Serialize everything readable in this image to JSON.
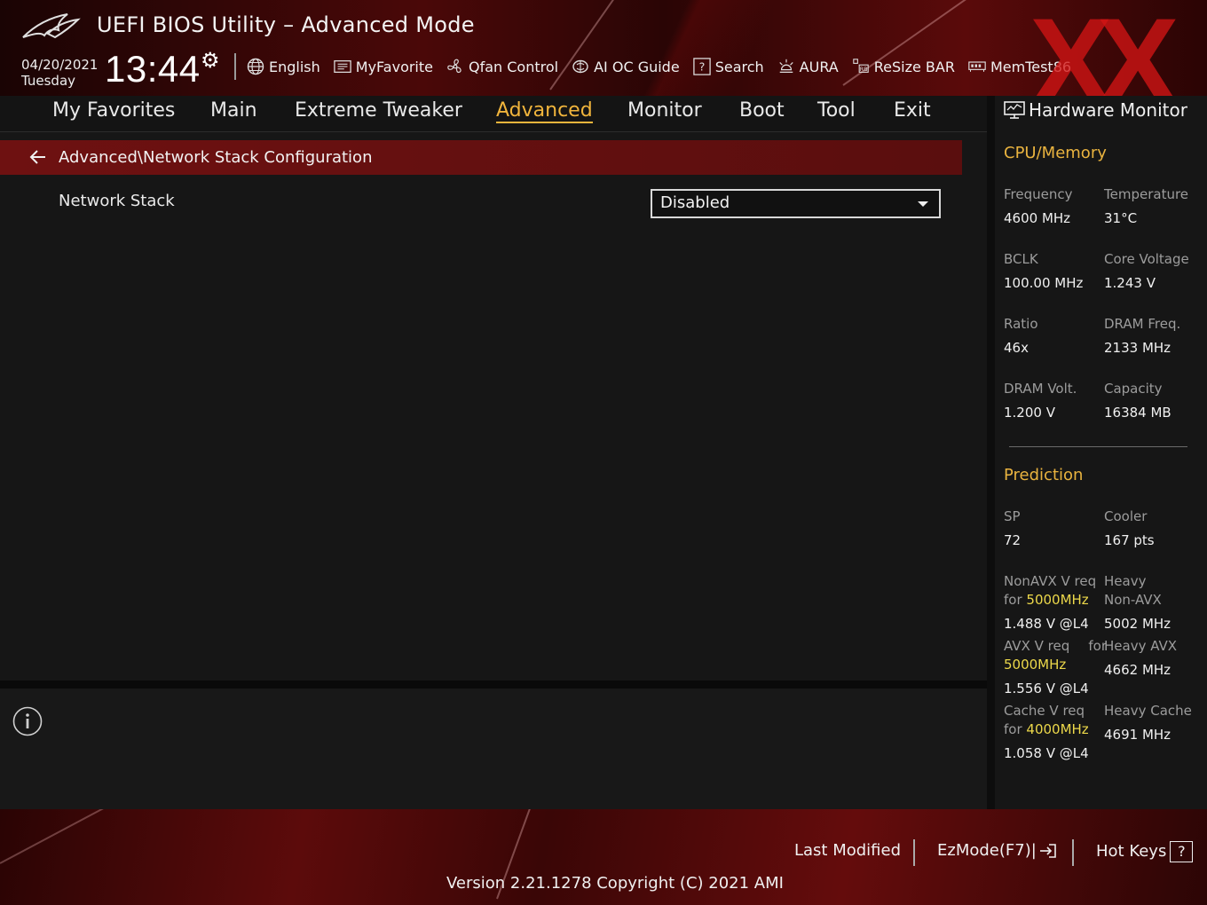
{
  "header": {
    "title": "UEFI BIOS Utility – Advanced Mode",
    "date": "04/20/2021",
    "weekday": "Tuesday",
    "time": "13:44",
    "watermark": "XX",
    "toolbar": [
      {
        "label": "English",
        "icon": "globe-icon"
      },
      {
        "label": "MyFavorite",
        "icon": "favorite-list-icon"
      },
      {
        "label": "Qfan Control",
        "icon": "fan-icon"
      },
      {
        "label": "AI OC Guide",
        "icon": "chip-icon"
      },
      {
        "label": "Search",
        "icon": "search-help-icon"
      },
      {
        "label": "AURA",
        "icon": "aura-light-icon"
      },
      {
        "label": "ReSize BAR",
        "icon": "resize-bar-icon"
      },
      {
        "label": "MemTest86",
        "icon": "memory-icon"
      }
    ]
  },
  "menu": {
    "items": [
      "My Favorites",
      "Main",
      "Extreme Tweaker",
      "Advanced",
      "Monitor",
      "Boot",
      "Tool",
      "Exit"
    ],
    "active": "Advanced"
  },
  "main": {
    "breadcrumb": "Advanced\\Network Stack Configuration",
    "settings": [
      {
        "label": "Network Stack",
        "value": "Disabled"
      }
    ]
  },
  "hardware_monitor": {
    "title": "Hardware Monitor",
    "cpu_memory": {
      "heading": "CPU/Memory",
      "frequency_label": "Frequency",
      "frequency": "4600 MHz",
      "temperature_label": "Temperature",
      "temperature": "31°C",
      "bclk_label": "BCLK",
      "bclk": "100.00 MHz",
      "core_voltage_label": "Core Voltage",
      "core_voltage": "1.243 V",
      "ratio_label": "Ratio",
      "ratio": "46x",
      "dram_freq_label": "DRAM Freq.",
      "dram_freq": "2133 MHz",
      "dram_volt_label": "DRAM Volt.",
      "dram_volt": "1.200 V",
      "capacity_label": "Capacity",
      "capacity": "16384 MB"
    },
    "prediction": {
      "heading": "Prediction",
      "sp_label": "SP",
      "sp": "72",
      "cooler_label": "Cooler",
      "cooler": "167 pts",
      "nonavx_label_1": "NonAVX V req",
      "nonavx_label_2": "for",
      "nonavx_freq": "5000MHz",
      "nonavx_value": "1.488 V @L4",
      "heavy_nonavx_label_1": "Heavy",
      "heavy_nonavx_label_2": "Non-AVX",
      "heavy_nonavx_value": "5002 MHz",
      "avx_label_1": "AVX V req",
      "avx_label_2": "for",
      "avx_freq": "5000MHz",
      "avx_value": "1.556 V @L4",
      "heavy_avx_label": "Heavy AVX",
      "heavy_avx_value": "4662 MHz",
      "cache_label_1": "Cache V req",
      "cache_label_2": "for",
      "cache_freq": "4000MHz",
      "cache_value": "1.058 V @L4",
      "heavy_cache_label": "Heavy Cache",
      "heavy_cache_value": "4691 MHz"
    }
  },
  "footer": {
    "last_modified": "Last Modified",
    "ezmode": "EzMode(F7)|",
    "hot_keys": "Hot Keys",
    "hot_keys_badge": "?",
    "version": "Version 2.21.1278 Copyright (C) 2021 AMI"
  },
  "colors": {
    "accent": "#f1b53c",
    "highlight": "#ecd84a",
    "breadcrumb_bg": "#6e1111",
    "watermark": "#d21414"
  }
}
